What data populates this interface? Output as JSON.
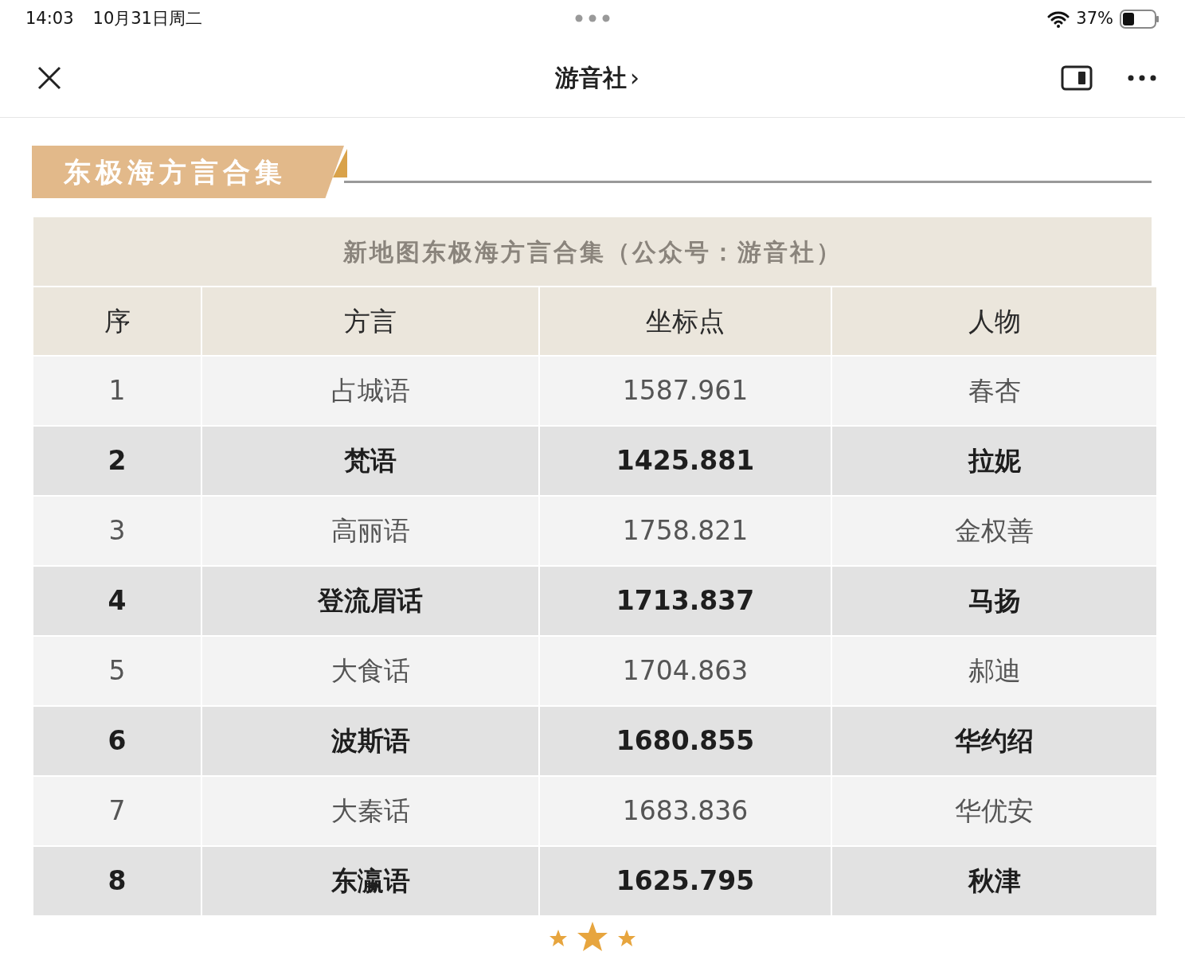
{
  "status_bar": {
    "time": "14:03",
    "date": "10月31日周二",
    "battery": "37%"
  },
  "nav": {
    "title": "游音社",
    "chevron": "›"
  },
  "section": {
    "title": "东极海方言合集"
  },
  "table": {
    "caption": "新地图东极海方言合集（公众号：游音社）",
    "columns": [
      "序",
      "方言",
      "坐标点",
      "人物"
    ],
    "rows": [
      [
        "1",
        "占城语",
        "1587.961",
        "春杏"
      ],
      [
        "2",
        "梵语",
        "1425.881",
        "拉妮"
      ],
      [
        "3",
        "高丽语",
        "1758.821",
        "金权善"
      ],
      [
        "4",
        "登流眉话",
        "1713.837",
        "马扬"
      ],
      [
        "5",
        "大食话",
        "1704.863",
        "郝迪"
      ],
      [
        "6",
        "波斯语",
        "1680.855",
        "华约绍"
      ],
      [
        "7",
        "大秦话",
        "1683.836",
        "华优安"
      ],
      [
        "8",
        "东瀛语",
        "1625.795",
        "秋津"
      ]
    ]
  }
}
